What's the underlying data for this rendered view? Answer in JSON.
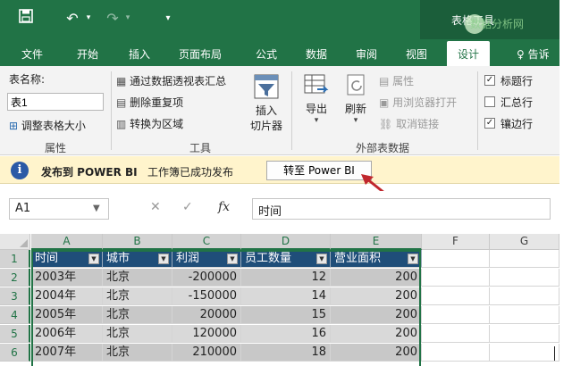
{
  "titlebar": {
    "context_title": "表格工具",
    "watermark": "数据分析网"
  },
  "tabs": [
    "文件",
    "开始",
    "插入",
    "页面布局",
    "公式",
    "数据",
    "审阅",
    "视图",
    "设计"
  ],
  "tab_active": "设计",
  "tab_tell": "告诉",
  "ribbon": {
    "properties": {
      "table_name_label": "表名称:",
      "table_name_value": "表1",
      "resize_label": "调整表格大小",
      "group_label": "属性"
    },
    "tools": {
      "pivot_label": "通过数据透视表汇总",
      "remove_dup_label": "删除重复项",
      "convert_label": "转换为区域",
      "slicer_label_1": "插入",
      "slicer_label_2": "切片器",
      "group_label": "工具"
    },
    "external": {
      "export_label": "导出",
      "refresh_label": "刷新",
      "properties_label": "属性",
      "open_browser_label": "用浏览器打开",
      "unlink_label": "取消链接",
      "group_label": "外部表数据"
    },
    "style_options": {
      "header_row_label": "标题行",
      "total_row_label": "汇总行",
      "banded_rows_label": "镶边行",
      "header_row_checked": "✓",
      "banded_rows_checked": "✓"
    }
  },
  "infobar": {
    "title": "发布到 POWER BI",
    "message": "工作簿已成功发布",
    "button_label": "转至 Power BI"
  },
  "formula": {
    "name_box": "A1",
    "fx_label": "fx",
    "value": "时间"
  },
  "sheet": {
    "columns": [
      "A",
      "B",
      "C",
      "D",
      "E",
      "F",
      "G"
    ],
    "rows": [
      "1",
      "2",
      "3",
      "4",
      "5",
      "6"
    ],
    "headers": [
      "时间",
      "城市",
      "利润",
      "员工数量",
      "营业面积"
    ],
    "data": [
      [
        "2003年",
        "北京",
        "-200000",
        "12",
        "200"
      ],
      [
        "2004年",
        "北京",
        "-150000",
        "14",
        "200"
      ],
      [
        "2005年",
        "北京",
        "20000",
        "15",
        "200"
      ],
      [
        "2006年",
        "北京",
        "120000",
        "16",
        "200"
      ],
      [
        "2007年",
        "北京",
        "210000",
        "18",
        "200"
      ]
    ]
  },
  "colors": {
    "excel_green": "#217346",
    "table_header": "#1f4e79",
    "info_bg": "#fff4cc",
    "arrow": "#c0272d"
  }
}
